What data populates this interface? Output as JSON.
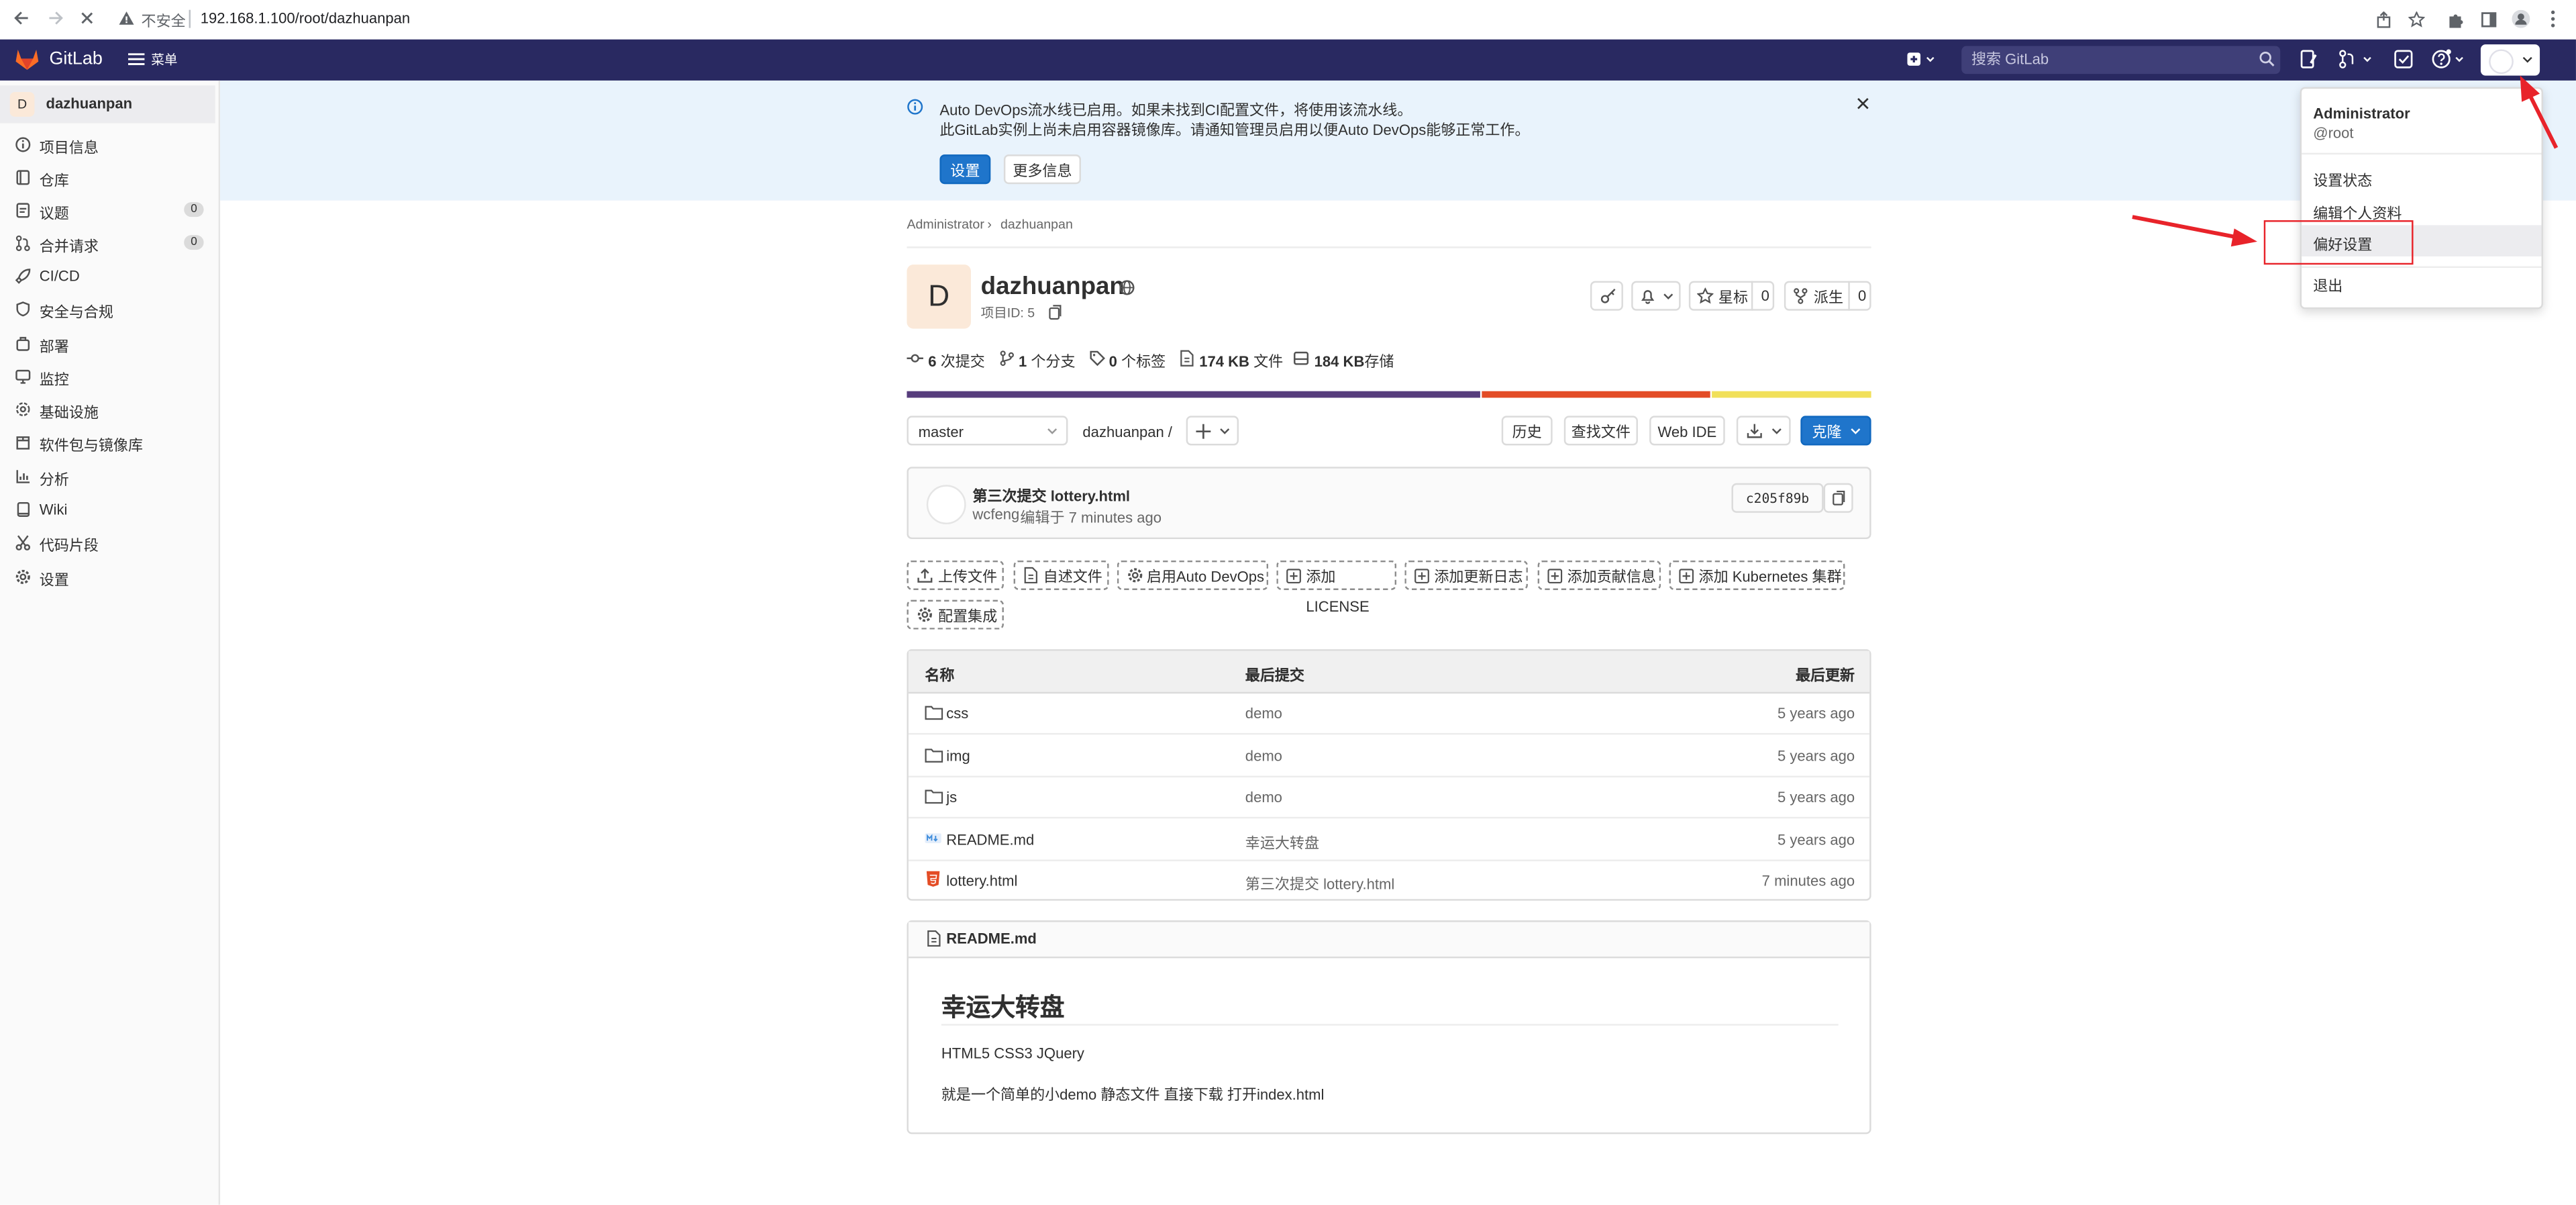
{
  "browser": {
    "insecure_label": "不安全",
    "url": "192.168.1.100/root/dazhuanpan"
  },
  "header": {
    "brand": "GitLab",
    "menu_label": "菜单",
    "search_placeholder": "搜索 GitLab"
  },
  "sidebar": {
    "project_initial": "D",
    "project_name": "dazhuanpan",
    "items": [
      {
        "label": "项目信息",
        "icon": "info-icon"
      },
      {
        "label": "仓库",
        "icon": "book-icon"
      },
      {
        "label": "议题",
        "icon": "issues-icon",
        "count": "0"
      },
      {
        "label": "合并请求",
        "icon": "merge-request-icon",
        "count": "0"
      },
      {
        "label": "CI/CD",
        "icon": "rocket-icon"
      },
      {
        "label": "安全与合规",
        "icon": "shield-icon"
      },
      {
        "label": "部署",
        "icon": "deploy-icon"
      },
      {
        "label": "监控",
        "icon": "monitor-icon"
      },
      {
        "label": "基础设施",
        "icon": "cloud-gear-icon"
      },
      {
        "label": "软件包与镜像库",
        "icon": "package-icon"
      },
      {
        "label": "分析",
        "icon": "chart-icon"
      },
      {
        "label": "Wiki",
        "icon": "wiki-icon"
      },
      {
        "label": "代码片段",
        "icon": "snippet-icon"
      },
      {
        "label": "设置",
        "icon": "gear-icon"
      }
    ]
  },
  "banner": {
    "line1": "Auto DevOps流水线已启用。如果未找到CI配置文件，将使用该流水线。",
    "line2": "此GitLab实例上尚未启用容器镜像库。请通知管理员启用以便Auto DevOps能够正常工作。",
    "settings_button": "设置",
    "more_info_button": "更多信息"
  },
  "breadcrumb": {
    "root": "Administrator",
    "current": "dazhuanpan"
  },
  "project": {
    "avatar_letter": "D",
    "name": "dazhuanpan",
    "id_label": "项目ID: 5",
    "star_label": "星标",
    "star_count": "0",
    "fork_label": "派生",
    "fork_count": "0"
  },
  "stats": {
    "commits_num": "6",
    "commits_label": "次提交",
    "branches_num": "1",
    "branches_label": "个分支",
    "tags_num": "0",
    "tags_label": "个标签",
    "files_size": "174 KB",
    "files_label": "文件",
    "storage_size": "184 KB",
    "storage_label": "存储"
  },
  "language_bar": [
    {
      "fraction": 0.597,
      "color": "#563d7c"
    },
    {
      "fraction": 0.238,
      "color": "#e34c26"
    },
    {
      "fraction": 0.165,
      "color": "#f1e05a"
    }
  ],
  "toolbar": {
    "branch": "master",
    "path": "dazhuanpan",
    "path_sep": "/",
    "history": "历史",
    "find_file": "查找文件",
    "web_ide": "Web IDE",
    "clone": "克隆"
  },
  "commit": {
    "title": "第三次提交 lottery.html",
    "author": "wcfeng",
    "meta": "编辑于 7 minutes ago",
    "sha": "c205f89b"
  },
  "quick_actions": [
    "上传文件",
    "自述文件",
    "启用Auto DevOps",
    "添加LICENSE",
    "添加更新日志",
    "添加贡献信息",
    "添加 Kubernetes 集群",
    "配置集成"
  ],
  "files": {
    "headers": {
      "name": "名称",
      "last_commit": "最后提交",
      "last_update": "最后更新"
    },
    "rows": [
      {
        "name": "css",
        "type": "folder",
        "commit": "demo",
        "updated": "5 years ago"
      },
      {
        "name": "img",
        "type": "folder",
        "commit": "demo",
        "updated": "5 years ago"
      },
      {
        "name": "js",
        "type": "folder",
        "commit": "demo",
        "updated": "5 years ago"
      },
      {
        "name": "README.md",
        "type": "markdown",
        "commit": "幸运大转盘",
        "updated": "5 years ago"
      },
      {
        "name": "lottery.html",
        "type": "html",
        "commit": "第三次提交 lottery.html",
        "updated": "7 minutes ago"
      }
    ]
  },
  "readme": {
    "filename": "README.md",
    "heading": "幸运大转盘",
    "line1": "HTML5 CSS3 JQuery",
    "line2": "就是一个简单的小demo 静态文件 直接下载 打开index.html"
  },
  "user_menu": {
    "name": "Administrator",
    "handle": "@root",
    "set_status": "设置状态",
    "edit_profile": "编辑个人资料",
    "preferences": "偏好设置",
    "sign_out": "退出"
  },
  "colors": {
    "header_bg": "#292961",
    "primary": "#1f75cb",
    "annotation_red": "#e8232a"
  }
}
